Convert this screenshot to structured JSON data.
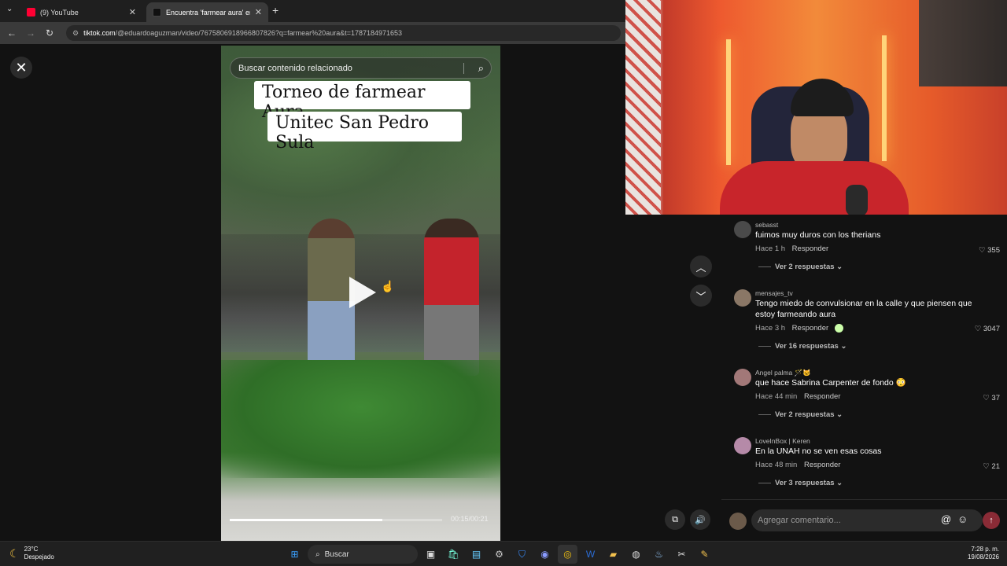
{
  "browser": {
    "tabs": [
      {
        "label": "(9) YouTube",
        "active": false,
        "icon": "youtube-icon",
        "color": "#ff0033"
      },
      {
        "label": "Encuentra 'farmear aura' en Tik",
        "active": true,
        "icon": "tiktok-icon",
        "color": "#ffffff"
      }
    ],
    "url_host": "tiktok.com",
    "url_path": "/@eduardoaguzman/video/7675806918966807826?q=farmear%20aura&t=1787184971653"
  },
  "search": {
    "placeholder": "Buscar contenido relacionado"
  },
  "video": {
    "caption_line1": "Torneo de farmear Aura",
    "caption_line2": "Unitec San Pedro Sula",
    "timecode": "00:15/00:21",
    "progress": 0.72
  },
  "comments": [
    {
      "user": "sebasst",
      "text": "fuimos muy duros con los therians",
      "time": "Hace 1 h",
      "reply": "Responder",
      "likes": "355",
      "more": "Ver 2 respuestas",
      "avatar_color": "#4a4a4a"
    },
    {
      "user": "mensajes_tv",
      "text": "Tengo miedo de convulsionar en la calle y que piensen que estoy farmeando aura",
      "time": "Hace 3 h",
      "reply": "Responder",
      "likes": "3047",
      "more": "Ver 16 respuestas",
      "avatar_color": "#8a7766"
    },
    {
      "user": "Angel palma 🪄🐱",
      "text": "que hace Sabrina Carpenter de fondo 😳",
      "time": "Hace 44 min",
      "reply": "Responder",
      "likes": "37",
      "more": "Ver 2 respuestas",
      "avatar_color": "#a27878"
    },
    {
      "user": "LoveInBox | Keren",
      "text": "En la UNAH no se ven esas cosas",
      "time": "Hace 48 min",
      "reply": "Responder",
      "likes": "21",
      "more": "Ver 3 respuestas",
      "avatar_color": "#b58aa8"
    }
  ],
  "comment_input": {
    "placeholder": "Agregar comentario..."
  },
  "taskbar": {
    "weather_temp": "23°C",
    "weather_desc": "Despejado",
    "search_label": "Buscar",
    "time": "7:28 p. m.",
    "date": "19/08/2026"
  },
  "colors": {
    "tiktok_red": "#fe2c55",
    "send_button": "#8a2b36",
    "bg": "#121212"
  }
}
